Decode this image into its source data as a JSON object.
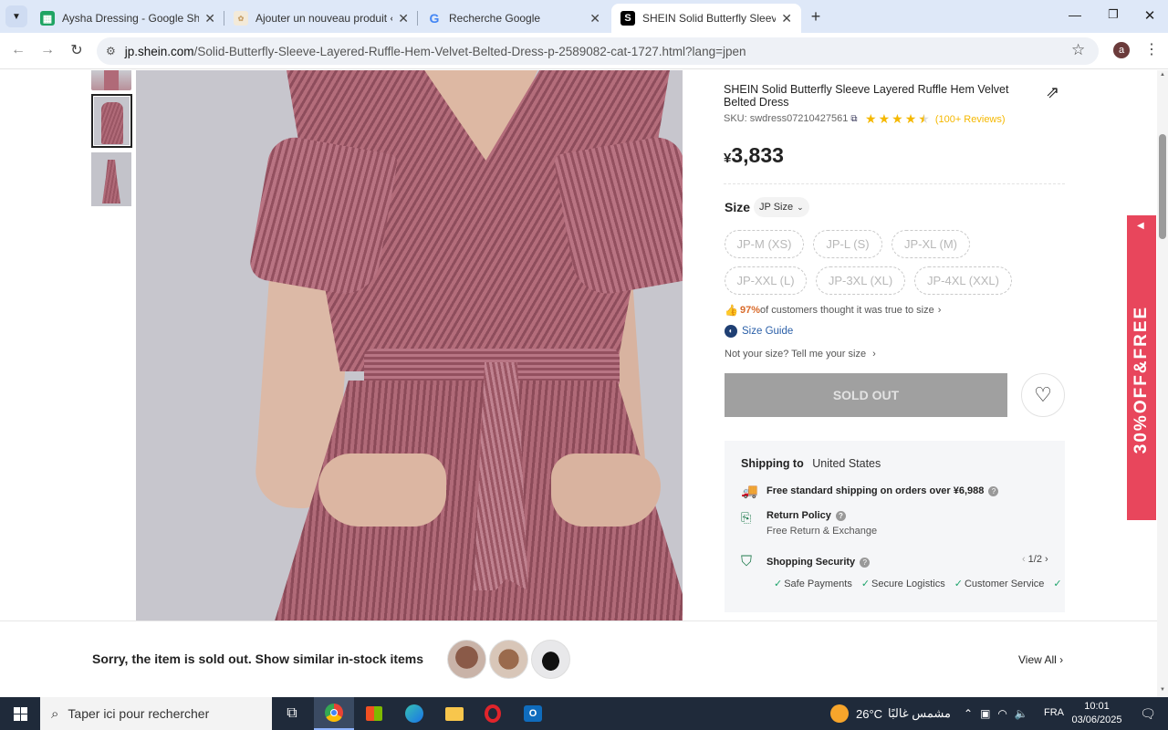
{
  "browser": {
    "tabs": [
      {
        "label": "Aysha Dressing - Google Sheets",
        "icon": "sheets-icon",
        "color": "#1fa463",
        "active": false
      },
      {
        "label": "Ajouter un nouveau produit ‹ Aysha",
        "icon": "site-favicon",
        "color": "#c9a26b",
        "active": false
      },
      {
        "label": "Recherche Google",
        "icon": "google-icon",
        "color": "#4285f4",
        "active": false
      },
      {
        "label": "SHEIN Solid Butterfly Sleeve Layered",
        "icon": "shein-icon",
        "color": "#000000",
        "active": true
      }
    ],
    "url_host": "jp.shein.com",
    "url_path": "/Solid-Butterfly-Sleeve-Layered-Ruffle-Hem-Velvet-Belted-Dress-p-2589082-cat-1727.html?lang=jpen",
    "profile_initial": "a"
  },
  "product": {
    "title": "SHEIN Solid Butterfly Sleeve Layered Ruffle Hem Velvet Belted Dress",
    "sku": "SKU: swdress07210427561",
    "rating": 4.5,
    "reviews": "(100+ Reviews)",
    "price_symbol": "¥",
    "price": "3,833",
    "size_label": "Size",
    "size_system": "JP Size",
    "sizes_row1": [
      "JP-M (XS)",
      "JP-L (S)",
      "JP-XL (M)"
    ],
    "sizes_row2": [
      "JP-XXL (L)",
      "JP-3XL (XL)",
      "JP-4XL (XXL)"
    ],
    "fit_percent": "97%",
    "fit_text": " of customers thought it was true to size",
    "size_guide": "Size Guide",
    "not_your_size": "Not your size? Tell me your size",
    "sold_out_label": "SOLD OUT",
    "dress_color": "#b06a78"
  },
  "shipping": {
    "label": "Shipping to",
    "country": "United States",
    "free_shipping": "Free standard shipping on orders over ¥6,988",
    "return_title": "Return Policy",
    "return_sub": "Free Return & Exchange",
    "security_title": "Shopping Security",
    "security_page": "1/2",
    "security_items": [
      "Safe Payments",
      "Secure Logistics",
      "Customer Service"
    ]
  },
  "promo": {
    "text": "30%OFF&FREE",
    "color": "#e8465c"
  },
  "soldbar": {
    "message": "Sorry, the item is sold out. Show similar in-stock items",
    "view_all": "View All"
  },
  "taskbar": {
    "search_placeholder": "Taper ici pour rechercher",
    "weather_temp": "26°C",
    "weather_text": "مشمس غالبًا",
    "language": "FRA",
    "time": "10:01",
    "date": "03/06/2025"
  }
}
